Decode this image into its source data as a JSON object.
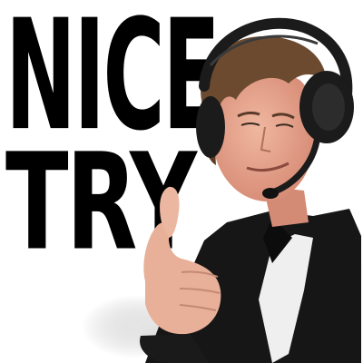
{
  "sticker": {
    "line1": "NICE",
    "line2": "TRY"
  },
  "colors": {
    "text": "#000000",
    "background": "#ffffff",
    "headset": "#1a1a1a",
    "skin": "#e9a58f",
    "hair": "#6b4a2f",
    "jacket": "#141414",
    "shirt": "#f2f2f2",
    "smoke": "#d9d9d9"
  },
  "icons": [
    "headset-icon",
    "thumbs-up-hand"
  ]
}
